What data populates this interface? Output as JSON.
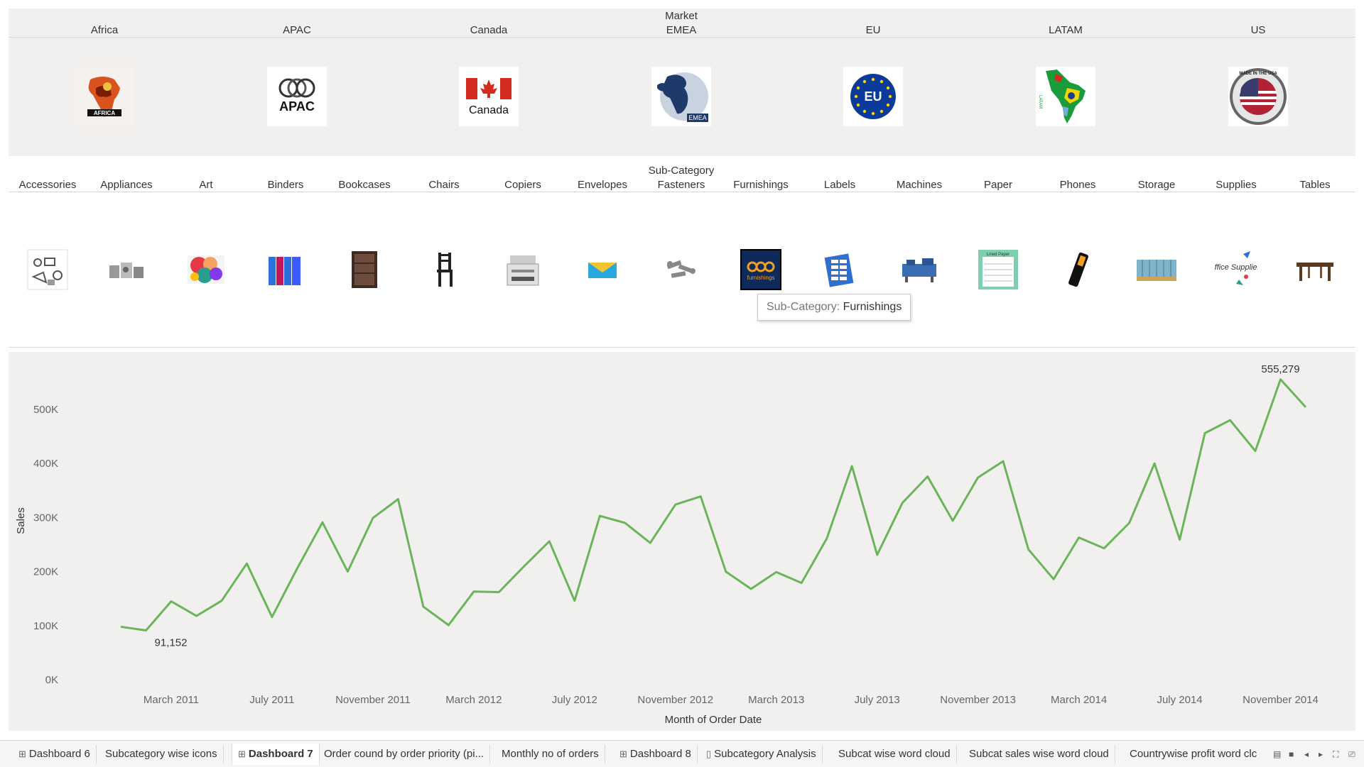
{
  "market": {
    "header": [
      "Market"
    ],
    "items": [
      {
        "label": "Africa",
        "icon": "africa-map-icon",
        "icon_text": "AFRICA"
      },
      {
        "label": "APAC",
        "icon": "apac-logo-icon",
        "icon_text": "APAC"
      },
      {
        "label": "Canada",
        "icon": "canada-flag-icon",
        "icon_text": "Canada"
      },
      {
        "label": "EMEA",
        "icon": "emea-globe-icon",
        "icon_text": "EMEA"
      },
      {
        "label": "EU",
        "icon": "eu-flag-icon",
        "icon_text": "EU"
      },
      {
        "label": "LATAM",
        "icon": "latam-map-icon",
        "icon_text": "LATAM"
      },
      {
        "label": "US",
        "icon": "made-in-usa-badge-icon",
        "icon_text": "MADE IN THE USA"
      }
    ]
  },
  "subcategory": {
    "header": "Sub-Category",
    "items": [
      {
        "label": "Accessories",
        "icon": "accessories-icon"
      },
      {
        "label": "Appliances",
        "icon": "appliances-icon"
      },
      {
        "label": "Art",
        "icon": "art-icon"
      },
      {
        "label": "Binders",
        "icon": "binders-icon"
      },
      {
        "label": "Bookcases",
        "icon": "bookcase-icon"
      },
      {
        "label": "Chairs",
        "icon": "chair-icon"
      },
      {
        "label": "Copiers",
        "icon": "copier-icon"
      },
      {
        "label": "Envelopes",
        "icon": "envelope-icon"
      },
      {
        "label": "Fasteners",
        "icon": "fasteners-icon"
      },
      {
        "label": "Furnishings",
        "icon": "furnishings-icon",
        "icon_text": "furnishings"
      },
      {
        "label": "Labels",
        "icon": "labels-icon"
      },
      {
        "label": "Machines",
        "icon": "machines-icon"
      },
      {
        "label": "Paper",
        "icon": "paper-icon",
        "icon_text": "Lined Paper"
      },
      {
        "label": "Phones",
        "icon": "phone-icon"
      },
      {
        "label": "Storage",
        "icon": "storage-icon"
      },
      {
        "label": "Supplies",
        "icon": "office-supplies-icon",
        "icon_text": "Office Supplies"
      },
      {
        "label": "Tables",
        "icon": "table-icon"
      }
    ]
  },
  "tooltip": {
    "key": "Sub-Category:",
    "value": "Furnishings"
  },
  "chart_data": {
    "type": "line",
    "xlabel": "Month of Order Date",
    "ylabel": "Sales",
    "ylim": [
      0,
      580000
    ],
    "yticks": [
      "0K",
      "100K",
      "200K",
      "300K",
      "400K",
      "500K"
    ],
    "ytick_values": [
      0,
      100000,
      200000,
      300000,
      400000,
      500000
    ],
    "xticks": [
      "March 2011",
      "July 2011",
      "November 2011",
      "March 2012",
      "July 2012",
      "November 2012",
      "March 2013",
      "July 2013",
      "November 2013",
      "March 2014",
      "July 2014",
      "November 2014"
    ],
    "xtick_index": [
      2,
      6,
      10,
      14,
      18,
      22,
      26,
      30,
      34,
      38,
      42,
      46
    ],
    "grid": false,
    "color": "#6ab55a",
    "series": [
      {
        "values": [
          98000,
          91152,
          145000,
          118000,
          146000,
          215000,
          116000,
          206000,
          291000,
          200000,
          299000,
          334000,
          135000,
          101000,
          163000,
          162000,
          210000,
          256000,
          146000,
          303000,
          290000,
          253000,
          324000,
          339000,
          200000,
          168000,
          199000,
          179000,
          261000,
          395000,
          231000,
          327000,
          376000,
          294000,
          374000,
          404000,
          241000,
          186000,
          263000,
          243000,
          290000,
          400000,
          259000,
          456000,
          480000,
          423000,
          555279,
          504000
        ]
      }
    ],
    "annotations": [
      {
        "text": "91,152"
      },
      {
        "text": "555,279"
      }
    ]
  },
  "tabs": [
    {
      "label": "Dashboard 6",
      "icon": "dashboard-icon",
      "active": false
    },
    {
      "label": "Subcategory wise icons",
      "icon": "",
      "active": false
    },
    {
      "label": "Dashboard 7",
      "icon": "dashboard-icon",
      "active": true
    },
    {
      "label": "Order cound by order priority (pi...",
      "icon": "",
      "active": false
    },
    {
      "label": "Monthly no of orders",
      "icon": "",
      "active": false
    },
    {
      "label": "Dashboard 8",
      "icon": "dashboard-icon",
      "active": false
    },
    {
      "label": "Subcategory Analysis",
      "icon": "story-icon",
      "active": false
    },
    {
      "label": "Subcat wise word cloud",
      "icon": "",
      "active": false
    },
    {
      "label": "Subcat sales wise word cloud",
      "icon": "",
      "active": false
    },
    {
      "label": "Countrywise profit word clc",
      "icon": "",
      "active": false
    }
  ]
}
